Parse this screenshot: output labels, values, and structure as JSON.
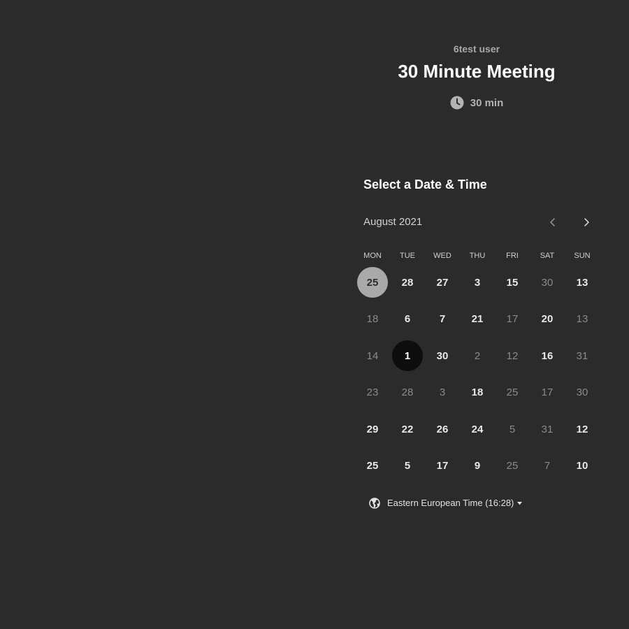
{
  "event": {
    "host": "6test user",
    "title": "30 Minute Meeting",
    "duration": "30 min",
    "duration_icon": "clock-icon"
  },
  "calendar": {
    "heading": "Select a Date & Time",
    "month_label": "August 2021",
    "prev_icon": "chevron-left-icon",
    "next_icon": "chevron-right-icon",
    "weekdays": [
      "MON",
      "TUE",
      "WED",
      "THU",
      "FRI",
      "SAT",
      "SUN"
    ],
    "days": [
      {
        "label": "25",
        "available": true,
        "today": true
      },
      {
        "label": "28",
        "available": true
      },
      {
        "label": "27",
        "available": true
      },
      {
        "label": "3",
        "available": true
      },
      {
        "label": "15",
        "available": true
      },
      {
        "label": "30",
        "available": false
      },
      {
        "label": "13",
        "available": true
      },
      {
        "label": "18",
        "available": false
      },
      {
        "label": "6",
        "available": true
      },
      {
        "label": "7",
        "available": true
      },
      {
        "label": "21",
        "available": true
      },
      {
        "label": "17",
        "available": false
      },
      {
        "label": "20",
        "available": true
      },
      {
        "label": "13",
        "available": false
      },
      {
        "label": "14",
        "available": false
      },
      {
        "label": "1",
        "available": true,
        "selected": true
      },
      {
        "label": "30",
        "available": true
      },
      {
        "label": "2",
        "available": false
      },
      {
        "label": "12",
        "available": false
      },
      {
        "label": "16",
        "available": true
      },
      {
        "label": "31",
        "available": false
      },
      {
        "label": "23",
        "available": false
      },
      {
        "label": "28",
        "available": false
      },
      {
        "label": "3",
        "available": false
      },
      {
        "label": "18",
        "available": true
      },
      {
        "label": "25",
        "available": false
      },
      {
        "label": "17",
        "available": false
      },
      {
        "label": "30",
        "available": false
      },
      {
        "label": "29",
        "available": true
      },
      {
        "label": "22",
        "available": true
      },
      {
        "label": "26",
        "available": true
      },
      {
        "label": "24",
        "available": true
      },
      {
        "label": "5",
        "available": false
      },
      {
        "label": "31",
        "available": false
      },
      {
        "label": "12",
        "available": true
      },
      {
        "label": "25",
        "available": true
      },
      {
        "label": "5",
        "available": true
      },
      {
        "label": "17",
        "available": true
      },
      {
        "label": "9",
        "available": true
      },
      {
        "label": "25",
        "available": false
      },
      {
        "label": "7",
        "available": false
      },
      {
        "label": "10",
        "available": true
      }
    ]
  },
  "timezone": {
    "label": "Eastern European Time (16:28)",
    "icon": "globe-icon",
    "dropdown_icon": "caret-down-icon"
  },
  "colors": {
    "background": "#2b2b2b",
    "today_circle": "#a9a9a9",
    "selected_circle": "#0d0d0d"
  }
}
